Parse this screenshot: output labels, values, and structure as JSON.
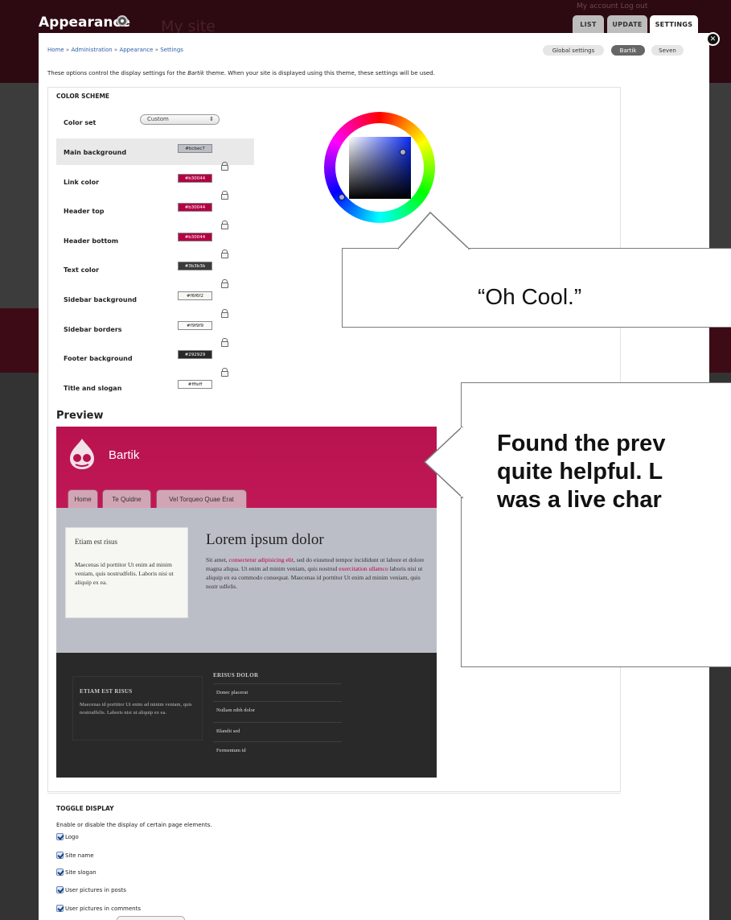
{
  "app": {
    "title": "Appearance",
    "site_name": "My site",
    "account_links": "My account    Log out"
  },
  "tabs": [
    {
      "label": "LIST",
      "active": false
    },
    {
      "label": "UPDATE",
      "active": false
    },
    {
      "label": "SETTINGS",
      "active": true
    }
  ],
  "breadcrumb": {
    "items": [
      "Home",
      "Administration",
      "Appearance",
      "Settings"
    ],
    "separator": "»"
  },
  "theme_pills": [
    {
      "label": "Global settings",
      "selected": false
    },
    {
      "label": "Bartik",
      "selected": true
    },
    {
      "label": "Seven",
      "selected": false
    }
  ],
  "intro": {
    "before": "These options control the display settings for the ",
    "theme": "Bartik",
    "after": " theme. When your site is displayed using this theme, these settings will be used."
  },
  "color_scheme": {
    "legend": "COLOR SCHEME",
    "color_set_label": "Color set",
    "color_set_value": "Custom",
    "fields": [
      {
        "label": "Main background",
        "value": "#bcbec7",
        "color": "#bcbec7",
        "text_color": "#222222"
      },
      {
        "label": "Link color",
        "value": "#b30044",
        "color": "#b30044",
        "text_color": "#ffffff"
      },
      {
        "label": "Header top",
        "value": "#b30044",
        "color": "#b30044",
        "text_color": "#ffffff"
      },
      {
        "label": "Header bottom",
        "value": "#b30044",
        "color": "#b30044",
        "text_color": "#ffffff"
      },
      {
        "label": "Text color",
        "value": "#3b3b3b",
        "color": "#3b3b3b",
        "text_color": "#ffffff"
      },
      {
        "label": "Sidebar background",
        "value": "#f6f6f2",
        "color": "#f6f6f2",
        "text_color": "#222222"
      },
      {
        "label": "Sidebar borders",
        "value": "#f9f9f9",
        "color": "#f9f9f9",
        "text_color": "#222222"
      },
      {
        "label": "Footer background",
        "value": "#292929",
        "color": "#292929",
        "text_color": "#ffffff"
      },
      {
        "label": "Title and slogan",
        "value": "#fffeff",
        "color": "#fffeff",
        "text_color": "#222222"
      }
    ]
  },
  "callouts": {
    "first": "“Oh Cool.”",
    "second_lines": [
      "Found the prev",
      "quite helpful. L",
      "was a live char"
    ]
  },
  "preview": {
    "heading": "Preview",
    "site_name": "Bartik",
    "tabs": [
      "Home",
      "Te Quidne",
      "Vel Torqueo Quae Erat"
    ],
    "sidebar_title": "Etiam est risus",
    "sidebar_text": "Maecenas id porttitor Ut enim ad minim veniam, quis nostrudfelis. Laboris nisi ut aliquip ex ea.",
    "main_title": "Lorem ipsum dolor",
    "main_text_1": "Sit amet, ",
    "main_link_1": "consectetur adipisicing elit",
    "main_text_2": ", sed do eiusmod tempor incididunt ut labore et dolore magna aliqua. Ut enim ad minim veniam, quis nostrud ",
    "main_link_2": "exercitation ullamco",
    "main_text_3": " laboris nisi ut aliquip ex ea commodo consequat. Maecenas id porttitor Ut enim ad minim veniam, quis nostr udfelis.",
    "footer_title_1": "ETIAM EST RISUS",
    "footer_text_1": "Maecenas id porttitor Ut enim ad minim veniam, quis nostrudfelis. Laboris nisi ut aliquip ex ea.",
    "footer_title_2": "ERISUS DOLOR",
    "footer_links": [
      "Donec placerat",
      "Nullam nibh dolor",
      "Blandit sed",
      "Fermentum id"
    ]
  },
  "toggle_display": {
    "legend": "TOGGLE DISPLAY",
    "description": "Enable or disable the display of certain page elements.",
    "items": [
      {
        "label": "Logo",
        "checked": true
      },
      {
        "label": "Site name",
        "checked": true
      },
      {
        "label": "Site slogan",
        "checked": true
      },
      {
        "label": "User pictures in posts",
        "checked": true
      },
      {
        "label": "User pictures in comments",
        "checked": true
      }
    ]
  },
  "colors": {
    "accent": "#b30044",
    "link": "#2a61a6",
    "preview_body": "#bcbec7",
    "preview_footer": "#292929"
  },
  "icons": {
    "close": "close-icon",
    "lock": "lock-icon",
    "appearance": "palette-icon",
    "drupal_logo": "drupal-drop-icon",
    "checkbox": "checkbox-checked-icon"
  }
}
